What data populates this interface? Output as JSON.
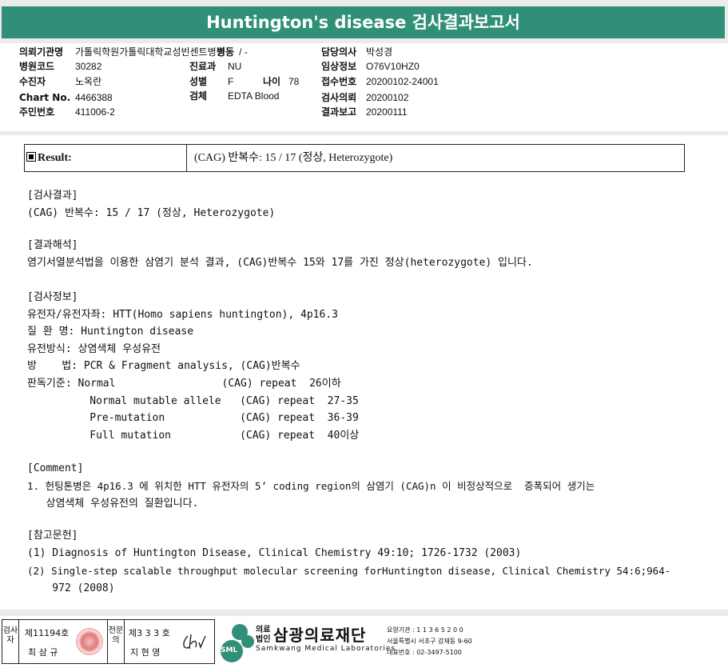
{
  "title": "Huntington's disease 검사결과보고서",
  "header_fields": [
    {
      "label": "의뢰기관명",
      "value": "가톨릭학원가톨릭대학교성빈센트병원"
    },
    {
      "label": "병동",
      "value": "/ -"
    },
    {
      "label": "담당의사",
      "value": "박성경"
    },
    {
      "label": "병원코드",
      "value": "30282"
    },
    {
      "label": "진료과",
      "value": "NU"
    },
    {
      "label": "임상정보",
      "value": "O76V10HZ0"
    },
    {
      "label": "수진자",
      "value": "노옥란"
    },
    {
      "label": "성별",
      "value": "F"
    },
    {
      "label": "나이",
      "value": "78"
    },
    {
      "label": "접수번호",
      "value": "20200102-24001"
    },
    {
      "label": "Chart No.",
      "value": "4466388"
    },
    {
      "label": "검체",
      "value": "EDTA Blood"
    },
    {
      "label": "검사의뢰",
      "value": "20200102"
    },
    {
      "label": "주민번호",
      "value": "411006-2"
    },
    {
      "label": "결과보고",
      "value": "20200111"
    }
  ],
  "result_box": {
    "label": "Result:",
    "value": "(CAG) 반복수: 15 / 17 (정상, Heterozygote)"
  },
  "sections": {
    "result_heading": "[검사결과]",
    "result_text": "(CAG) 반복수: 15 / 17 (정상, Heterozygote)",
    "interp_heading": "[결과해석]",
    "interp_text": "염기서열분석법을 이용한 삼염기 분석 결과, (CAG)반복수 15와 17를 가진 정상(heterozygote) 입니다.",
    "info_heading": "[검사정보]",
    "gene": "유전자/유전자좌: HTT(Homo sapiens huntington), 4p16.3",
    "disease": "질 환 명: Huntington disease",
    "inheritance": "유전방식: 상염색체 우성유전",
    "method": "방    법: PCR & Fragment analysis, (CAG)반복수",
    "criteria": [
      "판독기준: Normal                 (CAG) repeat  26이하",
      "          Normal mutable allele   (CAG) repeat  27-35",
      "          Pre-mutation            (CAG) repeat  36-39",
      "          Full mutation           (CAG) repeat  40이상"
    ],
    "comment_heading": "[Comment]",
    "comment_lines": [
      "1. 헌팅톤병은 4p16.3 에 위치한 HTT 유전자의 5’ coding region의 삼염기 (CAG)n 이 비정상적으로  증폭되어 생기는",
      "   상염색체 우성유전의 질환입니다."
    ],
    "ref_heading": "[참고문헌]",
    "ref_lines": [
      "(1) Diagnosis of Huntington Disease, Clinical Chemistry 49:10; 1726-1732 (2003)",
      "(2) Single-step scalable throughput molecular screening forHuntington disease, Clinical Chemistry 54:6;964-",
      "    972 (2008)"
    ]
  },
  "footer": {
    "inspector_label": "검사자",
    "inspector_no": "제11194호",
    "inspector_name": "최 삼 규",
    "specialist_label": "전문의",
    "specialist_no": "제3 3 3 호",
    "specialist_name": "지 현 영",
    "org_type": "의료 법인",
    "org_name": "삼광의료재단",
    "org_en": "Samkwang Medical Laboratories",
    "logo_text": "SML",
    "org_code": "요양기관 : 1 1 3 6 5 2 0 0",
    "org_addr": "서울특별시 서초구 강재동 9-60",
    "org_tel": "대표번호 : 02-3497-5100"
  }
}
